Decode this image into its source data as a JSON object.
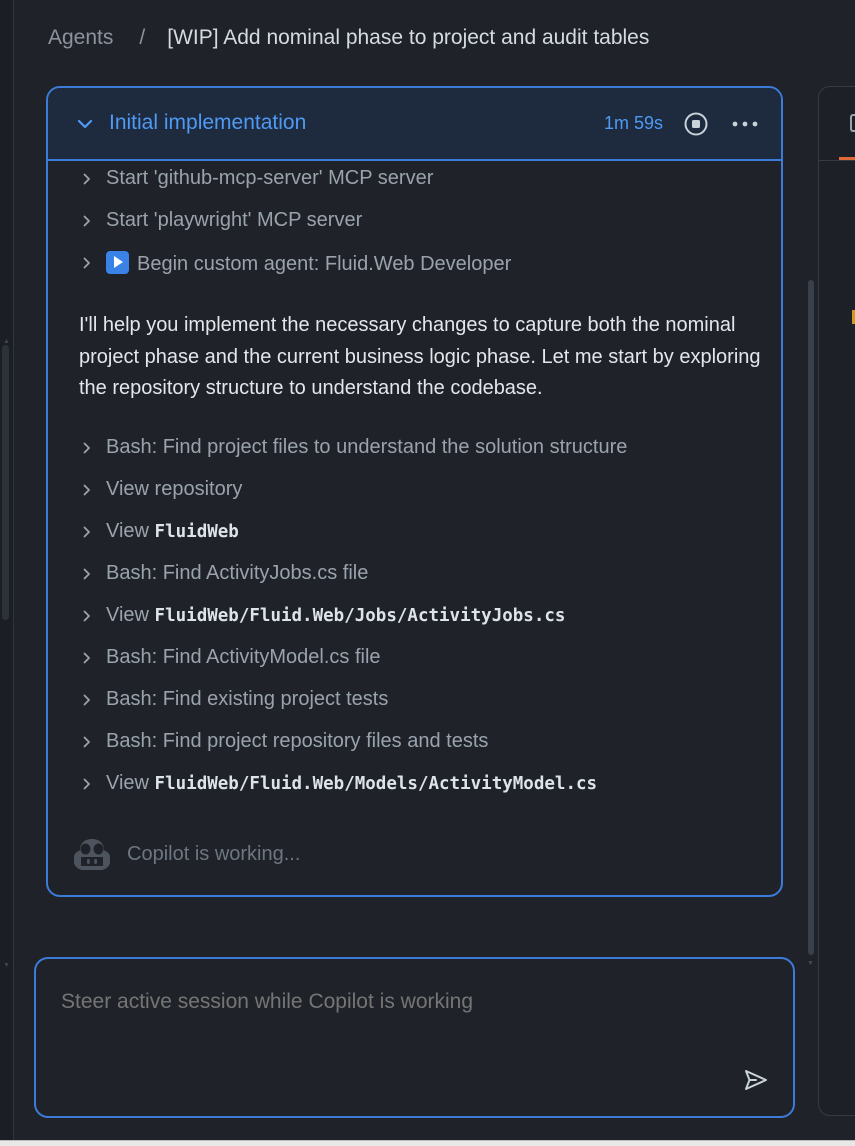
{
  "breadcrumb": {
    "root": "Agents",
    "separator": "/",
    "title": "[WIP] Add nominal phase to project and audit tables"
  },
  "session": {
    "title": "Initial implementation",
    "elapsed": "1m 59s",
    "expanded": true
  },
  "steps_before": [
    {
      "text": "Start 'github-mcp-server' MCP server"
    },
    {
      "text": "Start 'playwright' MCP server"
    },
    {
      "text": "Begin custom agent: Fluid.Web Developer",
      "icon": "play-button-emoji"
    }
  ],
  "message": "I'll help you implement the necessary changes to capture both the nominal project phase and the current business logic phase. Let me start by exploring the repository structure to understand the codebase.",
  "steps_after": [
    {
      "prefix": "Bash: Find project files to understand the solution structure",
      "code": ""
    },
    {
      "prefix": "View repository",
      "code": ""
    },
    {
      "prefix": "View ",
      "code": "FluidWeb"
    },
    {
      "prefix": "Bash: Find ActivityJobs.cs file",
      "code": ""
    },
    {
      "prefix": "View ",
      "code": "FluidWeb/Fluid.Web/Jobs/ActivityJobs.cs"
    },
    {
      "prefix": "Bash: Find ActivityModel.cs file",
      "code": ""
    },
    {
      "prefix": "Bash: Find existing project tests",
      "code": ""
    },
    {
      "prefix": "Bash: Find project repository files and tests",
      "code": ""
    },
    {
      "prefix": "View ",
      "code": "FluidWeb/Fluid.Web/Models/ActivityModel.cs"
    }
  ],
  "status": {
    "text": "Copilot is working..."
  },
  "input": {
    "placeholder": "Steer active session while Copilot is working",
    "value": ""
  },
  "colors": {
    "accent": "#3d7bd8",
    "accent_text": "#4e9af5",
    "background": "#1f2329"
  }
}
